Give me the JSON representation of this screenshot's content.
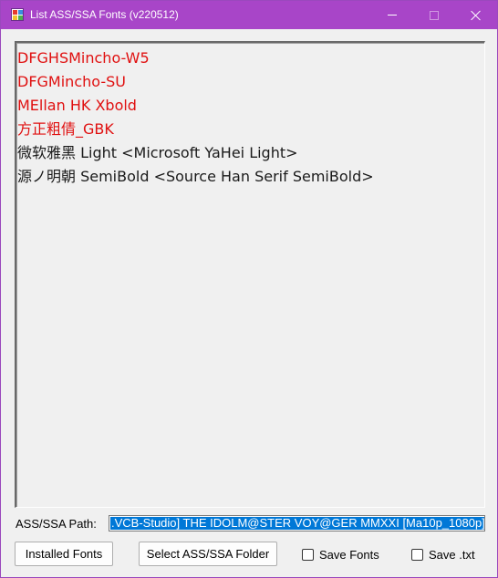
{
  "window": {
    "title": "List ASS/SSA Fonts (v220512)",
    "accent_color": "#a845c8"
  },
  "font_list": {
    "items": [
      {
        "text": "DFGHSMincho-W5",
        "status": "missing"
      },
      {
        "text": "DFGMincho-SU",
        "status": "missing"
      },
      {
        "text": "MEllan HK Xbold",
        "status": "missing"
      },
      {
        "text": "方正粗倩_GBK",
        "status": "missing"
      },
      {
        "text": "微软雅黑 Light <Microsoft YaHei Light>",
        "status": "found"
      },
      {
        "text": "源ノ明朝 SemiBold <Source Han Serif SemiBold>",
        "status": "found"
      }
    ],
    "missing_color": "#e01010",
    "found_color": "#1a1a1a"
  },
  "path": {
    "label": "ASS/SSA Path:",
    "value": ".VCB-Studio] THE IDOLM@STER VOY@GER MMXXI [Ma10p_1080p]"
  },
  "buttons": {
    "installed_fonts": "Installed Fonts",
    "select_folder": "Select ASS/SSA Folder"
  },
  "checkboxes": {
    "save_fonts": {
      "label": "Save Fonts",
      "checked": false
    },
    "save_txt": {
      "label": "Save .txt",
      "checked": false
    }
  },
  "icons": {
    "app": "app-icon",
    "minimize": "minimize-icon",
    "maximize": "maximize-icon",
    "close": "close-icon"
  }
}
